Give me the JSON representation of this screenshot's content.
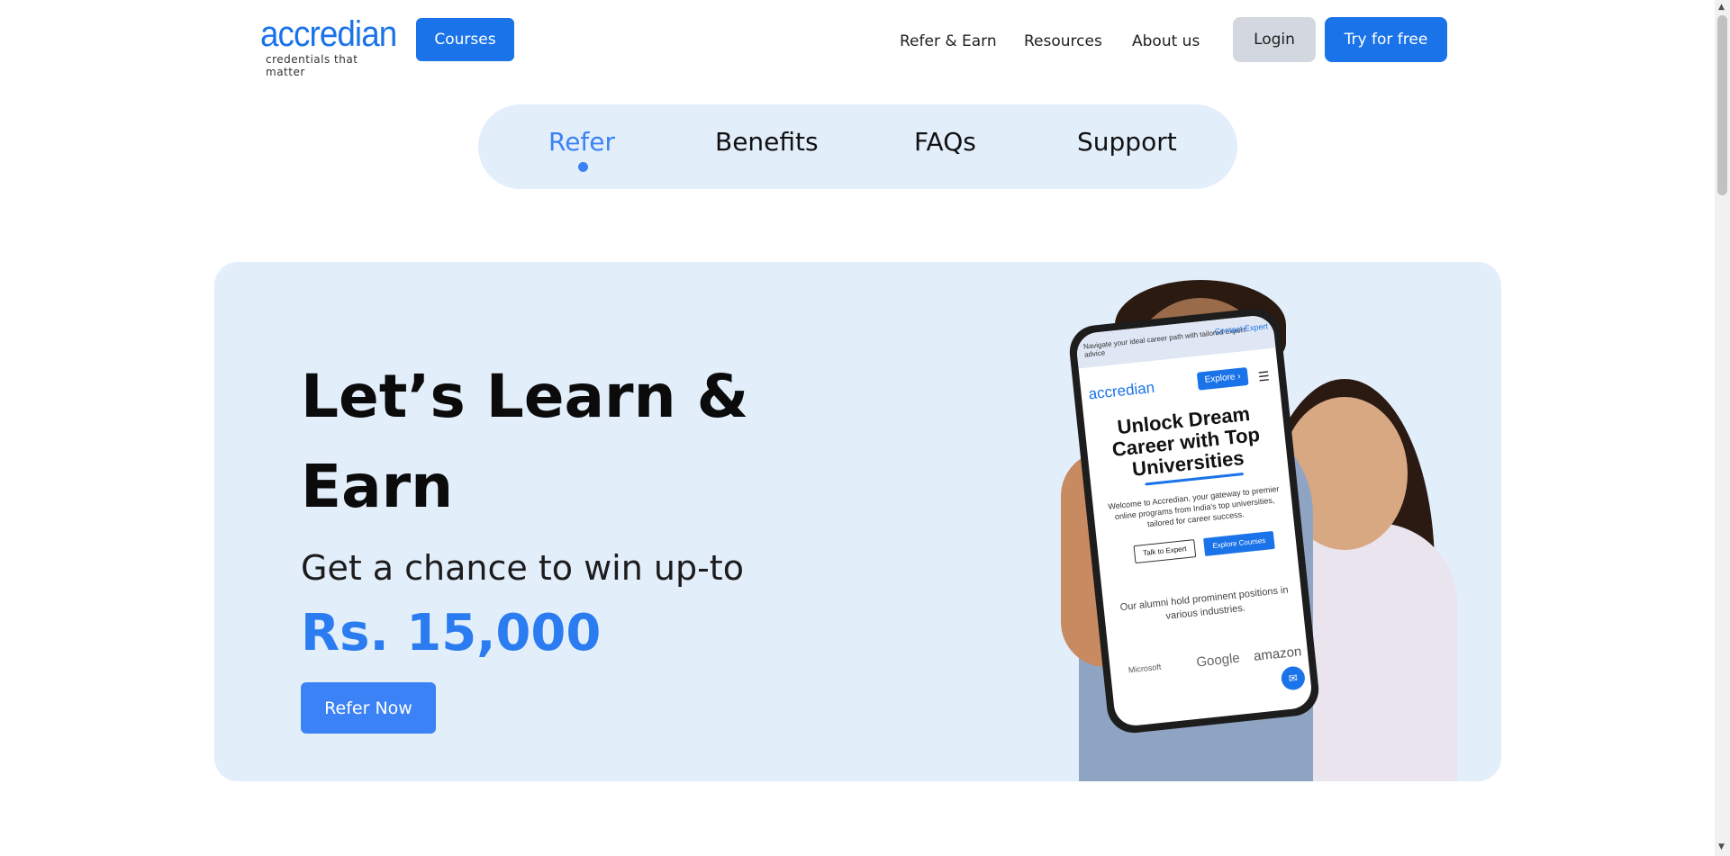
{
  "header": {
    "logo_text": "accredian",
    "logo_tagline": "credentials that matter",
    "courses_label": "Courses",
    "nav": {
      "refer_earn": "Refer & Earn",
      "resources": "Resources",
      "about_us": "About us"
    },
    "login_label": "Login",
    "try_label": "Try for free"
  },
  "tabs": {
    "items": [
      {
        "label": "Refer"
      },
      {
        "label": "Benefits"
      },
      {
        "label": "FAQs"
      },
      {
        "label": "Support"
      }
    ]
  },
  "hero": {
    "title": "Let’s Learn & Earn",
    "subtitle": "Get a chance to win up-to",
    "amount": "Rs. 15,000",
    "cta_label": "Refer Now"
  },
  "phone": {
    "top_text": "Navigate your ideal career path with tailored expert advice",
    "contact": "Contact Expert",
    "logo": "accredian",
    "explore": "Explore ›",
    "headline": "Unlock Dream Career with Top Universities",
    "description": "Welcome to Accredian, your gateway to premier online programs from India's top universities, tailored for career success.",
    "btn_talk": "Talk to Expert",
    "btn_explore": "Explore Courses",
    "alumni": "Our alumni hold prominent positions in various industries.",
    "brand1": "Microsoft",
    "brand2": "Google",
    "brand3": "amazon"
  },
  "colors": {
    "brand_blue": "#1a73e8",
    "accent_blue": "#3b82f6",
    "hero_bg": "#e3eefb"
  },
  "icons": {
    "dot": "active-tab-dot-icon",
    "menu": "hamburger-menu-icon",
    "chat": "chat-icon"
  }
}
